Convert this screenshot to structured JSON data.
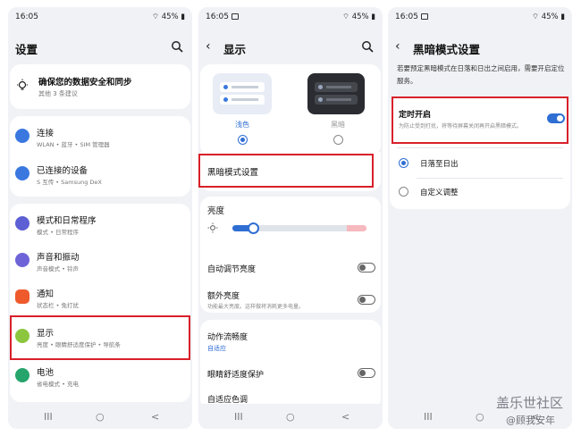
{
  "status": {
    "time": "16:05",
    "battery": "45%"
  },
  "colors": {
    "accent": "#2f6ed3",
    "highlight_box": "#d8202a"
  },
  "icons": {
    "search": "search-icon",
    "back": "back-arrow-icon",
    "nav_recent": "recent-apps-icon",
    "nav_home": "home-icon",
    "nav_back": "back-icon"
  },
  "nav": {
    "recent": "III",
    "home": "○",
    "back": "<"
  },
  "settings": {
    "title": "设置",
    "banner": {
      "label": "确保您的数据安全和同步",
      "sub": "其他 3 条建议"
    },
    "items": [
      {
        "label": "连接",
        "sub": "WLAN • 蓝牙 • SIM 管理器"
      },
      {
        "label": "已连接的设备",
        "sub": "S 互传 • Samsung DeX"
      },
      {
        "label": "模式和日常程序",
        "sub": "模式 • 日常程序"
      },
      {
        "label": "声音和振动",
        "sub": "声音模式 • 铃声"
      },
      {
        "label": "通知",
        "sub": "状态栏 • 免打扰"
      },
      {
        "label": "显示",
        "sub": "亮度 • 眼睛舒适度保护 • 导航条"
      },
      {
        "label": "电池",
        "sub": "省电模式 • 充电"
      }
    ]
  },
  "display": {
    "title": "显示",
    "light_label": "浅色",
    "dark_label": "黑暗",
    "dark_mode_settings": "黑暗模式设置",
    "brightness_label": "亮度",
    "brightness_level": 0.15,
    "auto_brightness": "自动调节亮度",
    "extra_brightness": "额外亮度",
    "extra_brightness_sub": "功能最大亮度。这样做将消耗更多电量。",
    "motion_smoothness": "动作流畅度",
    "motion_smoothness_value": "自适应",
    "eye_comfort": "眼睛舒适度保护",
    "adaptive_color": "自适应色调"
  },
  "dark_settings": {
    "title": "黑暗模式设置",
    "description": "若要预定黑暗模式在日落和日出之间启用，需要开启定位服务。",
    "scheduled_label": "定时开启",
    "scheduled_sub": "为防止受到打扰，将等待屏幕关闭再开启黑暗模式。",
    "scheduled_on": true,
    "option_sunset": "日落至日出",
    "option_custom": "自定义调整"
  },
  "watermark": {
    "line1": "盖乐世社区",
    "line2": "@顾我安年"
  }
}
